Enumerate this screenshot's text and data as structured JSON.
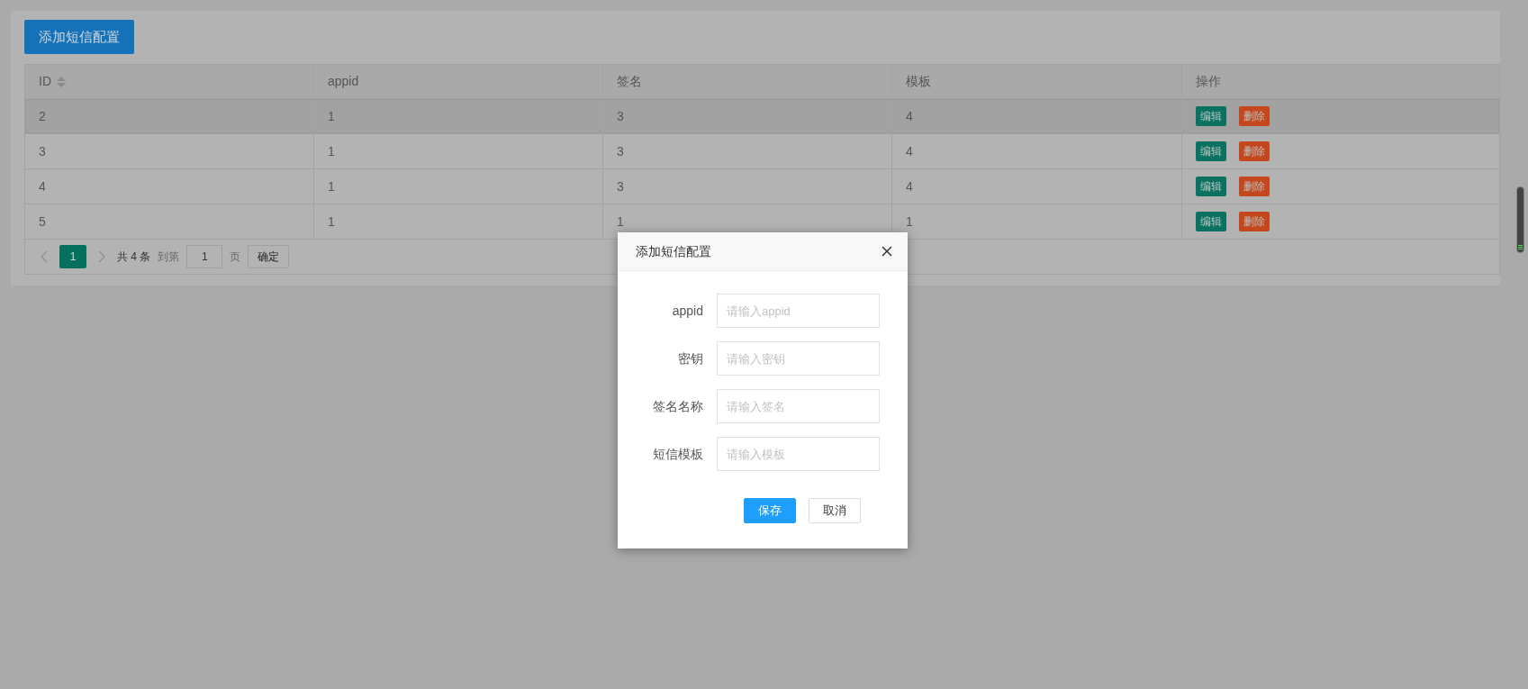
{
  "toolbar": {
    "add_button": "添加短信配置"
  },
  "table": {
    "columns": [
      {
        "label": "ID",
        "sortable": true
      },
      {
        "label": "appid",
        "sortable": false
      },
      {
        "label": "签名",
        "sortable": false
      },
      {
        "label": "模板",
        "sortable": false
      },
      {
        "label": "操作",
        "sortable": false
      }
    ],
    "rows": [
      {
        "hovered": true,
        "cells": [
          "2",
          "1",
          "3",
          "4"
        ],
        "actions": [
          {
            "kind": "edit",
            "label": "编辑"
          },
          {
            "kind": "delete",
            "label": "删除"
          }
        ]
      },
      {
        "hovered": false,
        "cells": [
          "3",
          "1",
          "3",
          "4"
        ],
        "actions": [
          {
            "kind": "edit",
            "label": "编辑"
          },
          {
            "kind": "delete",
            "label": "删除"
          }
        ]
      },
      {
        "hovered": false,
        "cells": [
          "4",
          "1",
          "3",
          "4"
        ],
        "actions": [
          {
            "kind": "edit",
            "label": "编辑"
          },
          {
            "kind": "delete",
            "label": "删除"
          }
        ]
      },
      {
        "hovered": false,
        "cells": [
          "5",
          "1",
          "1",
          "1"
        ],
        "actions": [
          {
            "kind": "edit",
            "label": "编辑"
          },
          {
            "kind": "delete",
            "label": "删除"
          }
        ]
      }
    ]
  },
  "pagination": {
    "pages": [
      {
        "label": "1",
        "selected": true
      }
    ],
    "total": "共 4 条",
    "goto_label": "到第",
    "goto_value": "1",
    "page_unit": "页",
    "confirm": "确定"
  },
  "dialog": {
    "title": "添加短信配置",
    "fields": [
      {
        "label": "appid",
        "placeholder": "请输入appid"
      },
      {
        "label": "密钥",
        "placeholder": "请输入密钥"
      },
      {
        "label": "签名名称",
        "placeholder": "请输入签名"
      },
      {
        "label": "短信模板",
        "placeholder": "请输入模板"
      }
    ],
    "buttons": [
      {
        "kind": "primary",
        "label": "保存"
      },
      {
        "kind": "default",
        "label": "取消"
      }
    ]
  }
}
